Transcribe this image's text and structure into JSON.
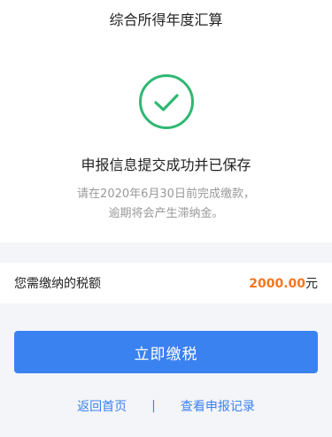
{
  "header": {
    "title": "综合所得年度汇算"
  },
  "result": {
    "icon": "check-circle-icon",
    "title": "申报信息提交成功并已保存",
    "desc_line1": "请在2020年6月30日前完成缴款，",
    "desc_line2": "逾期将会产生滞纳金。"
  },
  "amount": {
    "label": "您需缴纳的税额",
    "value": "2000.00",
    "unit": "元"
  },
  "actions": {
    "pay_label": "立即缴税",
    "back_label": "返回首页",
    "separator": "|",
    "records_label": "查看申报记录"
  },
  "colors": {
    "accent": "#3b82f1",
    "success": "#2fb873",
    "amount": "#f5761e"
  }
}
